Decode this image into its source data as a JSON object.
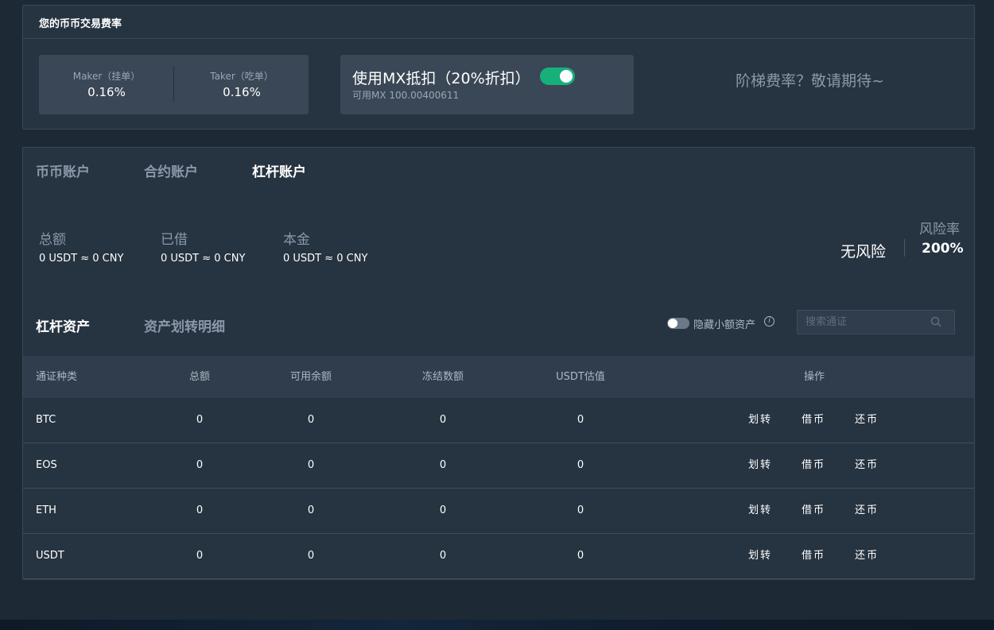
{
  "fee": {
    "title": "您的币币交易费率",
    "maker_label": "Maker（挂单）",
    "maker_value": "0.16%",
    "taker_label": "Taker（吃单）",
    "taker_value": "0.16%",
    "mx_title": "使用MX抵扣（20%折扣）",
    "mx_toggle_on": true,
    "mx_available": "可用MX 100.00400611",
    "ladder_text": "阶梯费率？敬请期待~"
  },
  "account_tabs": [
    "币币账户",
    "合约账户",
    "杠杆账户"
  ],
  "active_account_tab": "杠杆账户",
  "summary": {
    "total_label": "总额",
    "total_value": "0 USDT ≈ 0 CNY",
    "borrowed_label": "已借",
    "borrowed_value": "0 USDT ≈ 0 CNY",
    "principal_label": "本金",
    "principal_value": "0 USDT ≈ 0 CNY",
    "risk_label": "风险率",
    "risk_status": "无风险",
    "risk_value": "200%"
  },
  "sub_tabs": [
    "杠杆资产",
    "资产划转明细"
  ],
  "active_sub_tab": "杠杆资产",
  "hide_small_label": "隐藏小额资产",
  "search_placeholder": "搜索通证",
  "table": {
    "headers": [
      "通证种类",
      "总额",
      "可用余额",
      "冻结数额",
      "USDT估值",
      "操作"
    ],
    "rows": [
      {
        "coin": "BTC",
        "total": "0",
        "available": "0",
        "frozen": "0",
        "usdt": "0"
      },
      {
        "coin": "EOS",
        "total": "0",
        "available": "0",
        "frozen": "0",
        "usdt": "0"
      },
      {
        "coin": "ETH",
        "total": "0",
        "available": "0",
        "frozen": "0",
        "usdt": "0"
      },
      {
        "coin": "USDT",
        "total": "0",
        "available": "0",
        "frozen": "0",
        "usdt": "0"
      }
    ],
    "actions": [
      "划转",
      "借币",
      "还币"
    ]
  },
  "colors": {
    "background": "#1e2936",
    "panel": "#263340",
    "accent_green": "#17b07a",
    "muted_text": "#8b98aa"
  }
}
